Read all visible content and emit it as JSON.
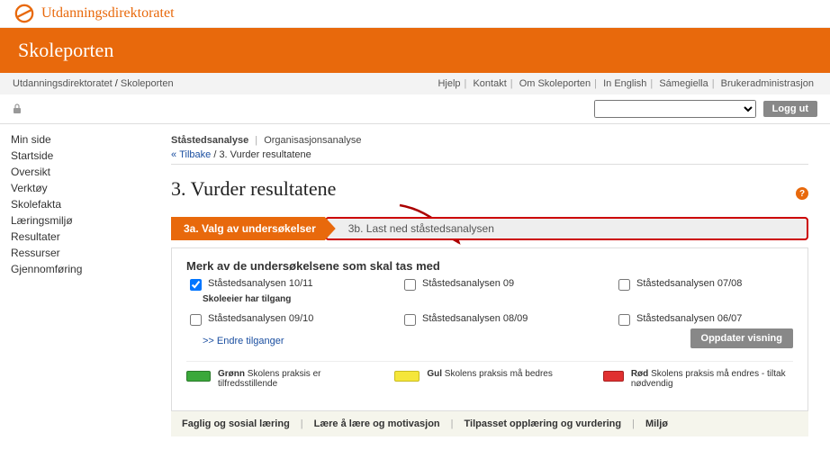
{
  "brand": {
    "directorate": "Utdanningsdirektoratet",
    "portal": "Skoleporten"
  },
  "top_breadcrumb": {
    "a": "Utdanningsdirektoratet",
    "b": "Skoleporten"
  },
  "util_links": [
    "Hjelp",
    "Kontakt",
    "Om Skoleporten",
    "In English",
    "Sámegiella",
    "Brukeradministrasjon"
  ],
  "login": {
    "logout_label": "Logg ut"
  },
  "sidebar": {
    "items": [
      "Min side",
      "Startside",
      "Oversikt",
      "Verktøy",
      "Skolefakta",
      "Læringsmiljø",
      "Resultater",
      "Ressurser",
      "Gjennomføring"
    ]
  },
  "breadcrumb_main": {
    "a": "Ståstedsanalyse",
    "b": "Organisasjonsanalyse",
    "back_label": "Tilbake",
    "back_tail": "3. Vurder resultatene"
  },
  "page_title": "3. Vurder resultatene",
  "tabs": {
    "a": "3a. Valg av undersøkelser",
    "b": "3b. Last ned ståstedsanalysen"
  },
  "panel": {
    "title": "Merk av de undersøkelsene som skal tas med",
    "rows": [
      {
        "c1": "Ståstedsanalysen 10/11",
        "c2": "Ståstedsanalysen 09",
        "c3": "Ståstedsanalysen 07/08"
      },
      {
        "c1": "Ståstedsanalysen 09/10",
        "c2": "Ståstedsanalysen 08/09",
        "c3": "Ståstedsanalysen 06/07"
      }
    ],
    "sub_note": "Skoleeier har tilgang",
    "change_access": ">> Endre tilganger",
    "update_btn": "Oppdater visning"
  },
  "legend": {
    "green": {
      "name": "Grønn",
      "text": "Skolens praksis er tilfredsstillende"
    },
    "yellow": {
      "name": "Gul",
      "text": "Skolens praksis må bedres"
    },
    "red": {
      "name": "Rød",
      "text": "Skolens praksis må endres - tiltak nødvendig"
    }
  },
  "bottom_tabs": [
    "Faglig og sosial læring",
    "Lære å lære og motivasjon",
    "Tilpasset opplæring og vurdering",
    "Miljø"
  ]
}
